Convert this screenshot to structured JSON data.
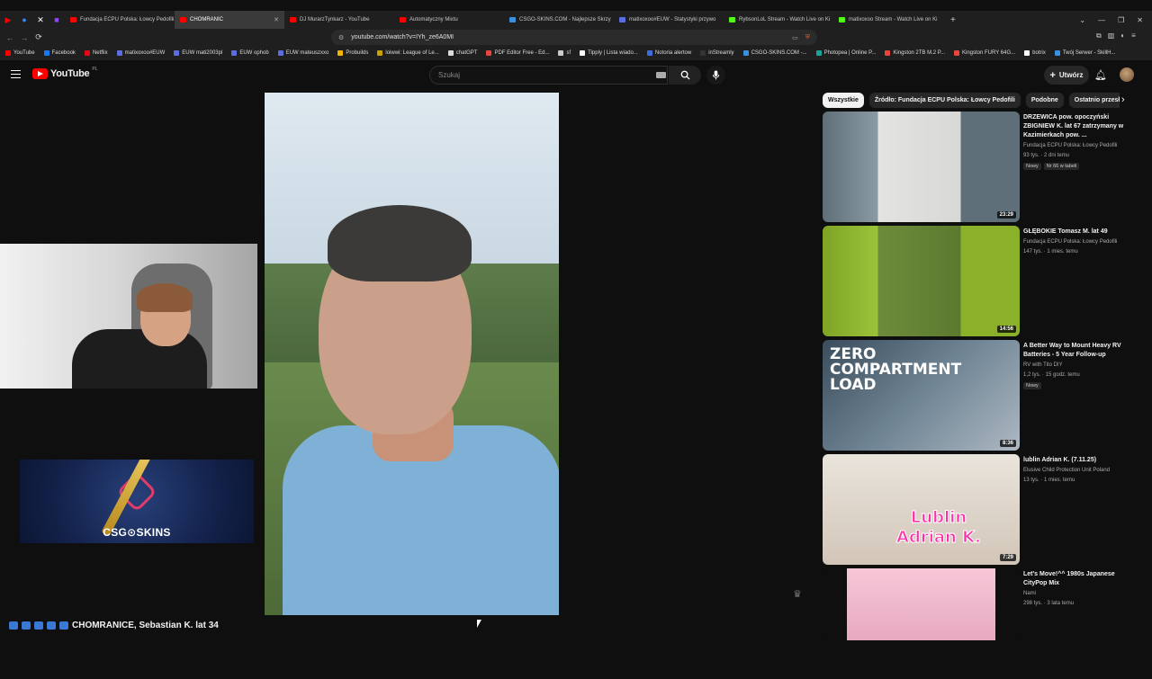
{
  "browser": {
    "tabs": [
      {
        "title": "Fundacja ECPU Polska: Łowcy Pedofili",
        "color": "#ff0000",
        "active": false
      },
      {
        "title": "CHOMRANIC",
        "color": "#ff0000",
        "active": true
      },
      {
        "title": "DJ MurarzTynkarz - YouTube",
        "color": "#ff0000",
        "active": false
      },
      {
        "title": "Automatyczny Mixtu",
        "color": "#ff0000",
        "active": false
      },
      {
        "title": "CSGO-SKINS.COM - Najlepsze Skrzy",
        "color": "#3d8fe0",
        "active": false
      },
      {
        "title": "matixoxoo#EUW - Statystyki przywo",
        "color": "#5b6ee1",
        "active": false
      },
      {
        "title": "RybsonLoL Stream - Watch Live on Ki",
        "color": "#53fc18",
        "active": false
      },
      {
        "title": "matixoxoo Stream - Watch Live on Ki",
        "color": "#53fc18",
        "active": false
      }
    ],
    "new_tab": "+",
    "url": "youtube.com/watch?v=IYh_ze6A0MI",
    "bookmarks": [
      {
        "label": "YouTube",
        "color": "#ff0000"
      },
      {
        "label": "Facebook",
        "color": "#1877f2"
      },
      {
        "label": "Netflix",
        "color": "#e50914"
      },
      {
        "label": "matixoxoo#EUW",
        "color": "#5b6ee1"
      },
      {
        "label": "EUW mati2003pl",
        "color": "#5b6ee1"
      },
      {
        "label": "EUW ophob",
        "color": "#5b6ee1"
      },
      {
        "label": "EUW mateuszxxo",
        "color": "#5b6ee1"
      },
      {
        "label": "Probuilds",
        "color": "#f0b400"
      },
      {
        "label": "loiwwi: League of Le...",
        "color": "#c8a200"
      },
      {
        "label": "chatGPT",
        "color": "#dddddd"
      },
      {
        "label": "PDF Editor Free - Ed...",
        "color": "#e8453c"
      },
      {
        "label": "sf",
        "color": "#cccccc"
      },
      {
        "label": "Tipply | Lista wiado...",
        "color": "#ffffff"
      },
      {
        "label": "Notoria alertow",
        "color": "#3d6ee1"
      },
      {
        "label": "inStreamly",
        "color": "#333333"
      },
      {
        "label": "CSGO-SKINS.COM -...",
        "color": "#3d8fe0"
      },
      {
        "label": "Photopea | Online P...",
        "color": "#18a497"
      },
      {
        "label": "Kingston 2TB M.2 P...",
        "color": "#e8453c"
      },
      {
        "label": "Kingston FURY 64G...",
        "color": "#e8453c"
      },
      {
        "label": "botrix",
        "color": "#ffffff"
      },
      {
        "label": "Twój Serwer - SkillH...",
        "color": "#3d8fe0"
      }
    ]
  },
  "youtube": {
    "logo_text": "YouTube",
    "region": "PL",
    "search_placeholder": "Szukaj",
    "create_label": "Utwórz",
    "video_title": "CHOMRANICE, Sebastian K. lat 34",
    "ad_logo": "CSG⊙SKINS",
    "chips": [
      "Wszystkie",
      "Źródło: Fundacja ECPU Polska: Łowcy Pedofili",
      "Podobne",
      "Ostatnio przesłane"
    ],
    "recommendations": [
      {
        "title": "DRZEWICA pow. opoczyński ZBIGNIEW K. lat 67 zatrzymany w Kazimierkach pow. ...",
        "channel": "Fundacja ECPU Polska: Łowcy Pedofili",
        "stats": "93 tys. · 2 dni temu",
        "badges": [
          "Nowy",
          "Nr 66 w tabeli"
        ],
        "duration": "23:29"
      },
      {
        "title": "GŁĘBOKIE Tomasz M. lat 49",
        "channel": "Fundacja ECPU Polska: Łowcy Pedofili",
        "stats": "147 tys. · 1 mies. temu",
        "badges": [],
        "duration": "14:56"
      },
      {
        "title": "A Better Way to Mount Heavy RV Batteries - 5 Year Follow-up",
        "channel": "RV with Tito DIY",
        "stats": "1,2 tys. · 15 godz. temu",
        "badges": [
          "Nowy"
        ],
        "duration": "8:36",
        "overlay": "ZERO COMPARTMENT LOAD"
      },
      {
        "title": "lublin Adrian K. (7.11.25)",
        "channel": "Elusive Child Protection Unit Poland",
        "stats": "13 tys. · 1 mies. temu",
        "badges": [],
        "duration": "7:29",
        "overlay": "Lublin Adrian K."
      },
      {
        "title": "Let's Move!^^ 1980s Japanese CityPop Mix",
        "channel": "Nami",
        "stats": "298 tys. · 3 lata temu",
        "badges": [],
        "duration": ""
      }
    ]
  }
}
